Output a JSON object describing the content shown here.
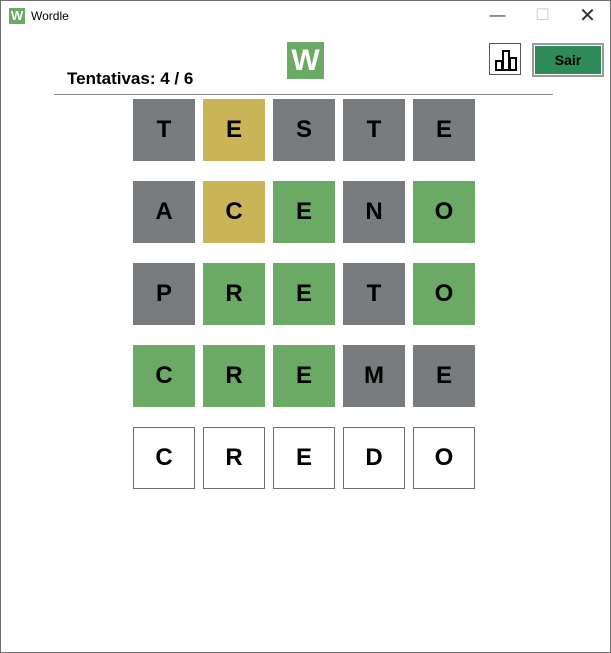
{
  "window": {
    "title": "Wordle",
    "icon_letter": "W",
    "minimize": "—",
    "maximize": "☐",
    "close": "✕"
  },
  "header": {
    "logo_letter": "W",
    "attempts": "Tentativas: 4 / 6",
    "exit_label": "Sair",
    "stats_icon": "bar-chart-icon"
  },
  "colors": {
    "green": "#6aaa64",
    "yellow": "#c9b458",
    "gray": "#787c7e",
    "exit": "#2e8b57"
  },
  "board": {
    "rows": [
      {
        "tiles": [
          {
            "letter": "T",
            "state": "gray"
          },
          {
            "letter": "E",
            "state": "yellow"
          },
          {
            "letter": "S",
            "state": "gray"
          },
          {
            "letter": "T",
            "state": "gray"
          },
          {
            "letter": "E",
            "state": "gray"
          }
        ]
      },
      {
        "tiles": [
          {
            "letter": "A",
            "state": "gray"
          },
          {
            "letter": "C",
            "state": "yellow"
          },
          {
            "letter": "E",
            "state": "green"
          },
          {
            "letter": "N",
            "state": "gray"
          },
          {
            "letter": "O",
            "state": "green"
          }
        ]
      },
      {
        "tiles": [
          {
            "letter": "P",
            "state": "gray"
          },
          {
            "letter": "R",
            "state": "green"
          },
          {
            "letter": "E",
            "state": "green"
          },
          {
            "letter": "T",
            "state": "gray"
          },
          {
            "letter": "O",
            "state": "green"
          }
        ]
      },
      {
        "tiles": [
          {
            "letter": "C",
            "state": "green"
          },
          {
            "letter": "R",
            "state": "green"
          },
          {
            "letter": "E",
            "state": "green"
          },
          {
            "letter": "M",
            "state": "gray"
          },
          {
            "letter": "E",
            "state": "gray"
          }
        ]
      },
      {
        "tiles": [
          {
            "letter": "C",
            "state": "empty"
          },
          {
            "letter": "R",
            "state": "empty"
          },
          {
            "letter": "E",
            "state": "empty"
          },
          {
            "letter": "D",
            "state": "empty"
          },
          {
            "letter": "O",
            "state": "empty"
          }
        ]
      }
    ]
  }
}
